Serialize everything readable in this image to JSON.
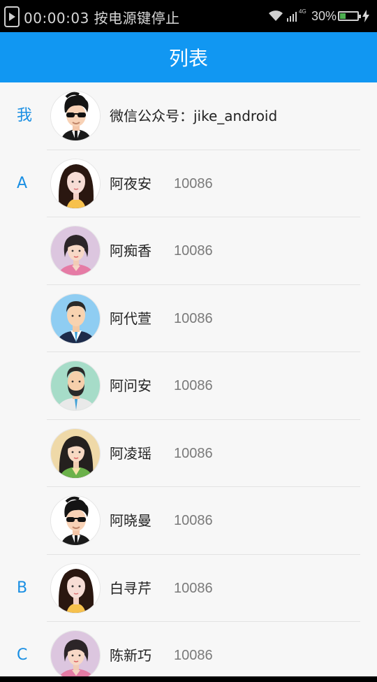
{
  "status_bar": {
    "recording_text": "00:00:03  按电源键停止",
    "network": "4G",
    "battery": "30%"
  },
  "app_bar": {
    "title": "列表"
  },
  "contacts": [
    {
      "letter": "我",
      "name": "微信公众号：jike_android",
      "phone": "",
      "avatar": "cool-guy"
    },
    {
      "letter": "A",
      "name": "阿夜安",
      "phone": "10086",
      "avatar": "long-hair-woman"
    },
    {
      "letter": "",
      "name": "阿痴香",
      "phone": "10086",
      "avatar": "pink-woman"
    },
    {
      "letter": "",
      "name": "阿代萱",
      "phone": "10086",
      "avatar": "suit-man"
    },
    {
      "letter": "",
      "name": "阿问安",
      "phone": "10086",
      "avatar": "bearded-man"
    },
    {
      "letter": "",
      "name": "阿凌瑶",
      "phone": "10086",
      "avatar": "green-woman"
    },
    {
      "letter": "",
      "name": "阿晓曼",
      "phone": "10086",
      "avatar": "cool-guy"
    },
    {
      "letter": "B",
      "name": "白寻芹",
      "phone": "10086",
      "avatar": "long-hair-woman"
    },
    {
      "letter": "C",
      "name": "陈新巧",
      "phone": "10086",
      "avatar": "pink-woman"
    }
  ],
  "colors": {
    "app_bar": "#1197f2",
    "index_letter": "#1a8fe3",
    "background": "#f7f7f7"
  }
}
